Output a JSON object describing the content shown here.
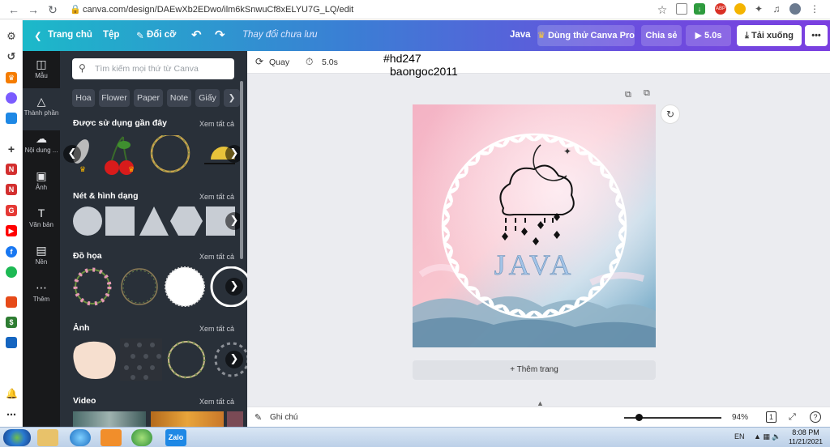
{
  "browser": {
    "url": "canva.com/design/DAEwXb2EDwo/ilm6kSnwuCf8xELYU7G_LQ/edit",
    "extensions": [
      "ABP"
    ]
  },
  "topbar": {
    "home": "Trang chủ",
    "file": "Tệp",
    "resize": "Đổi cỡ",
    "status": "Thay đổi chưa lưu",
    "design_title": "Java",
    "try_pro": "Dùng thử Canva Pro",
    "share": "Chia sẻ",
    "play_duration": "5.0s",
    "download": "Tải xuống",
    "more": "•••"
  },
  "leftnav": {
    "items": [
      {
        "label": "Mẫu",
        "icon": "layout-icon"
      },
      {
        "label": "Thành phần",
        "icon": "shapes-icon"
      },
      {
        "label": "Nội dung ...",
        "icon": "upload-icon"
      },
      {
        "label": "Ảnh",
        "icon": "photo-icon"
      },
      {
        "label": "Văn bản",
        "icon": "text-icon"
      },
      {
        "label": "Nền",
        "icon": "background-icon"
      },
      {
        "label": "Thêm",
        "icon": "more-dots-icon"
      }
    ]
  },
  "panel": {
    "search_placeholder": "Tìm kiếm mọi thứ từ Canva",
    "chips": [
      "Hoa",
      "Flower",
      "Paper",
      "Note",
      "Giấy"
    ],
    "sections": [
      {
        "title": "Được sử dụng gần đây",
        "see_all": "Xem tất cả"
      },
      {
        "title": "Nét & hình dạng",
        "see_all": "Xem tất cả"
      },
      {
        "title": "Đồ họa",
        "see_all": "Xem tất cả"
      },
      {
        "title": "Ảnh",
        "see_all": "Xem tất cả"
      },
      {
        "title": "Video",
        "see_all": "Xem tất cả"
      }
    ]
  },
  "editor": {
    "toolbar_rotate": "Quay",
    "toolbar_duration": "5.0s",
    "overlay_line1": "#hd247",
    "overlay_line2": "baongoc2011",
    "design_text": "JAVA",
    "add_page": "+ Thêm trang",
    "notes": "Ghi chú",
    "zoom": "94%",
    "page_count": "1",
    "help": "?"
  },
  "taskbar": {
    "lang": "EN",
    "time": "8:08 PM",
    "date": "11/21/2021",
    "zalo_label": "Zalo"
  },
  "colors": {
    "topbar_start": "#1cb9c9",
    "topbar_end": "#7b3fe0",
    "nav_bg": "#18191b",
    "panel_bg": "#293039",
    "editor_bg": "#ebecf0"
  }
}
